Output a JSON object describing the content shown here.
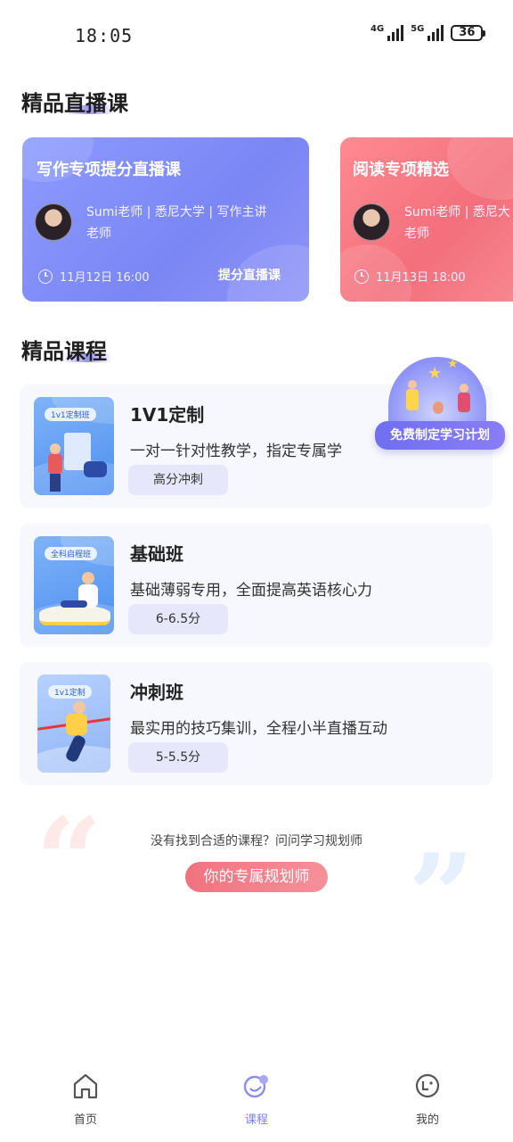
{
  "status_bar": {
    "time": "18:05",
    "signal_1_label": "4G",
    "signal_2_label": "5G",
    "battery": "36"
  },
  "live_section": {
    "title": "精品直播课",
    "cards": [
      {
        "title": "写作专项提分直播课",
        "teacher_line1": "Sumi老师 | 悉尼大学 | 写作主讲",
        "teacher_line2": "老师",
        "time": "11月12日 16:00",
        "tag": "提分直播课",
        "color": "#8b96fb"
      },
      {
        "title": "阅读专项精选",
        "teacher_line1": "Sumi老师 | 悉尼大",
        "teacher_line2": "老师",
        "time": "11月13日 18:00",
        "color": "#f6808a"
      }
    ]
  },
  "course_section": {
    "title": "精品课程",
    "promo": "免费制定学习计划",
    "courses": [
      {
        "title": "1V1定制",
        "desc": "一对一针对性教学，指定专属学",
        "tag": "高分冲刺",
        "thumb_label": "1v1定制班"
      },
      {
        "title": "基础班",
        "desc": "基础薄弱专用，全面提高英语核心力",
        "tag": "6-6.5分",
        "thumb_label": "全科启程班"
      },
      {
        "title": "冲刺班",
        "desc": "最实用的技巧集训，全程小半直播互动",
        "tag": "5-5.5分",
        "thumb_label": "1v1定制"
      }
    ]
  },
  "help": {
    "text": "没有找到合适的课程？问问学习规划师",
    "button": "你的专属规划师"
  },
  "tabbar": {
    "items": [
      {
        "label": "首页",
        "icon": "home-icon",
        "active": false
      },
      {
        "label": "课程",
        "icon": "course-icon",
        "active": true
      },
      {
        "label": "我的",
        "icon": "profile-icon",
        "active": false
      }
    ],
    "accent": "#7d7de8"
  }
}
